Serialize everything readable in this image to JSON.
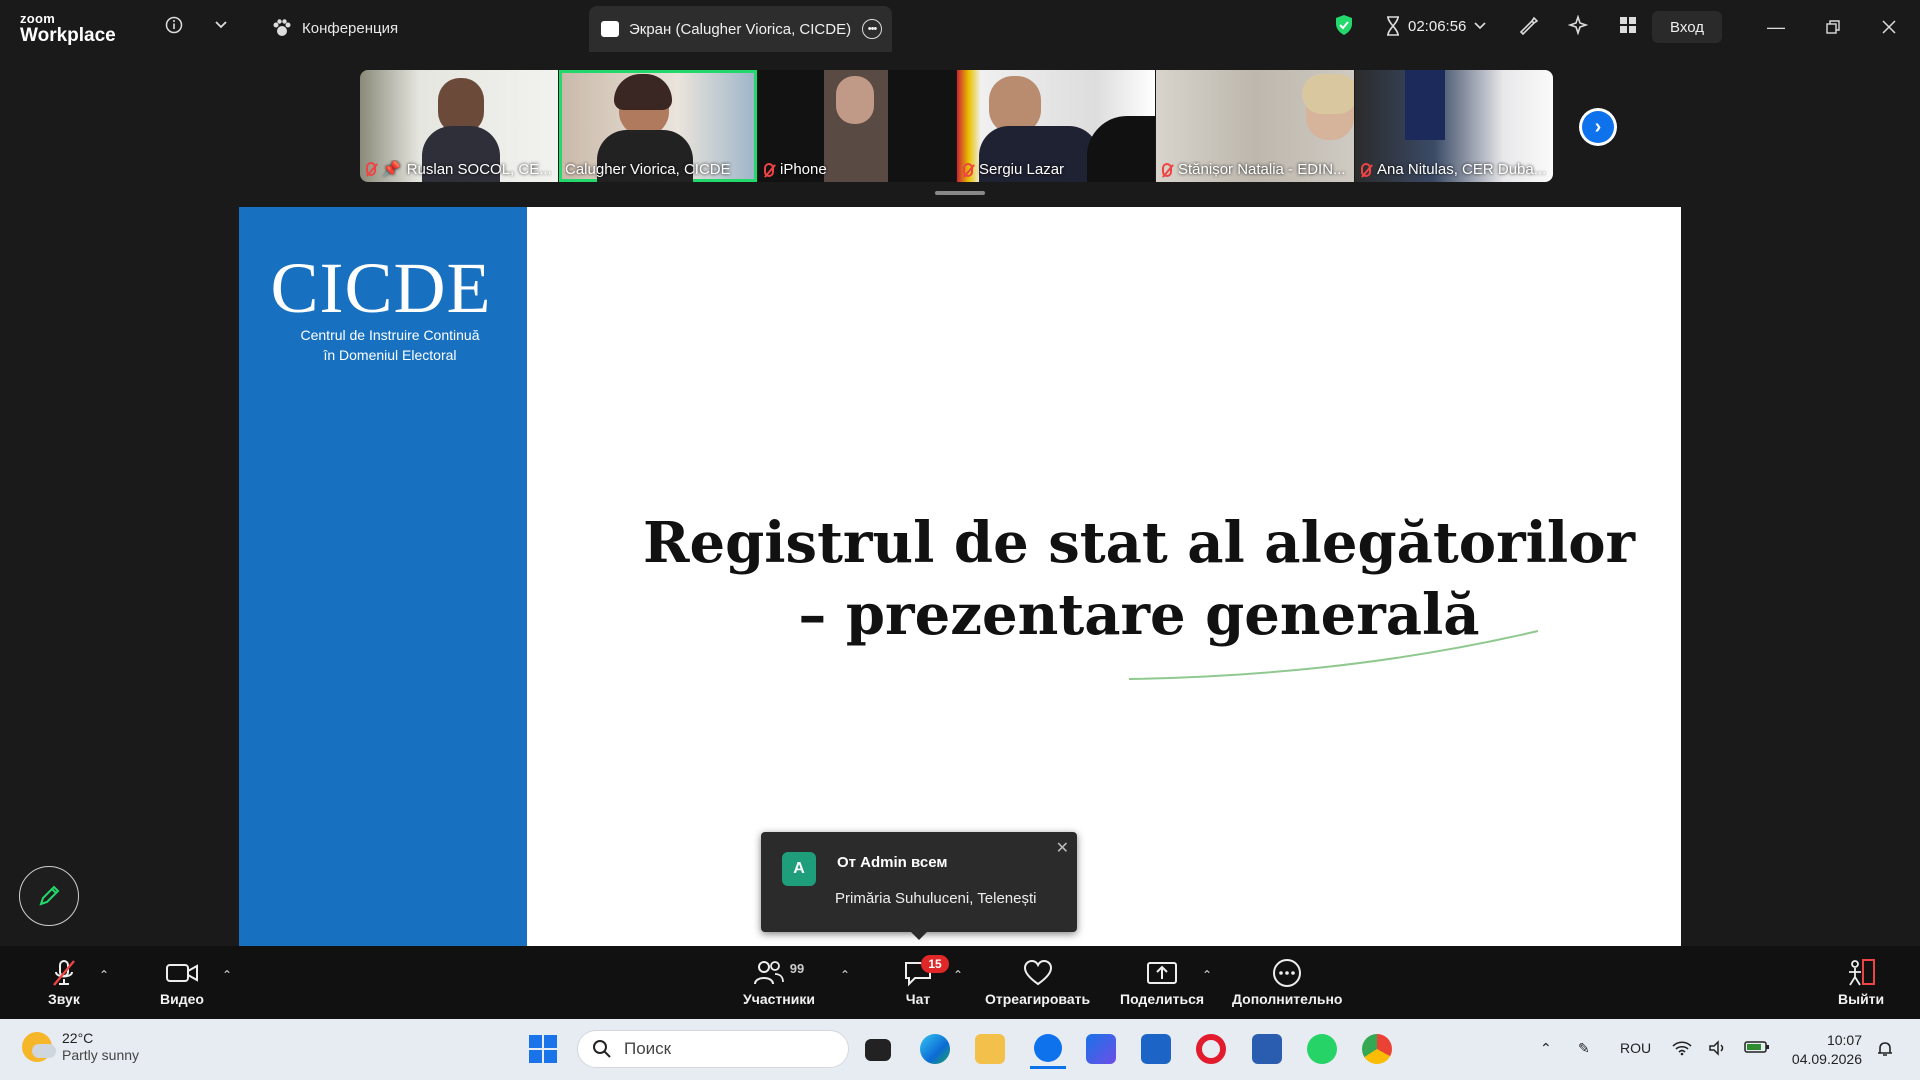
{
  "window": {
    "logo_top": "zoom",
    "logo_bottom": "Workplace",
    "tab_meeting": "Конференция",
    "tab_screen": "Экран (Calugher Viorica, CICDE)",
    "timer": "02:06:56",
    "enter_label": "Вход"
  },
  "participants": [
    {
      "name": "Ruslan SOCOL, CE...",
      "muted": true,
      "pinned": true
    },
    {
      "name": "Calugher Viorica, CICDE",
      "muted": false,
      "active": true
    },
    {
      "name": "iPhone",
      "muted": true
    },
    {
      "name": "Sergiu Lazar",
      "muted": true
    },
    {
      "name": "Stănișor Natalia - EDIN...",
      "muted": true
    },
    {
      "name": "Ana Nitulas, CER Duba...",
      "muted": true
    }
  ],
  "slide": {
    "logo_text": "CICDE",
    "logo_sub_1": "Centrul de Instruire Continuă",
    "logo_sub_2": "în Domeniul Electoral",
    "title_line_1": "Registrul de stat al alegătorilor",
    "title_line_2": "– prezentare generală"
  },
  "chat_notification": {
    "avatar": "A",
    "from": "От Admin всем",
    "message": "Primăria Suhuluceni, Telenești"
  },
  "toolbar": {
    "audio": "Звук",
    "video": "Видео",
    "participants": "Участники",
    "participants_count": "99",
    "chat": "Чат",
    "chat_badge": "15",
    "react": "Отреагировать",
    "share": "Поделиться",
    "more": "Дополнительно",
    "leave": "Выйти"
  },
  "taskbar": {
    "temp": "22°C",
    "weather": "Partly sunny",
    "search_placeholder": "Поиск",
    "lang": "ROU",
    "time": "10:07",
    "date": "04.09.2026"
  },
  "colors": {
    "accent_blue": "#0e72ed",
    "slide_blue": "#1771c0",
    "active_green": "#23d96b",
    "badge_red": "#e02828"
  }
}
